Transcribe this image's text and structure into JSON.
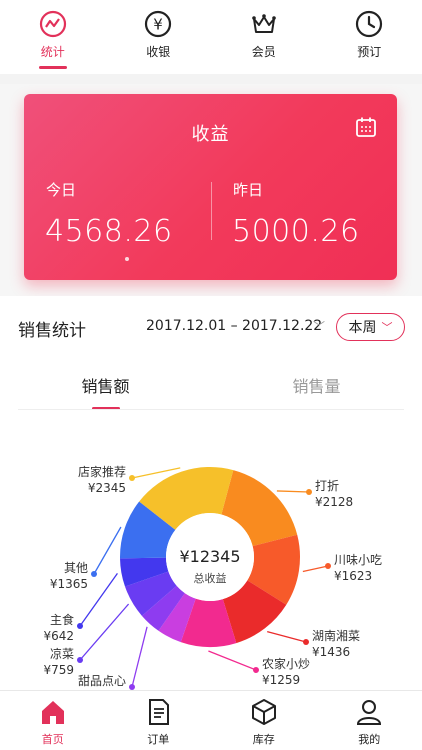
{
  "top_tabs": [
    {
      "label": "统计",
      "icon": "trend-icon",
      "active": true
    },
    {
      "label": "收银",
      "icon": "yen-icon",
      "active": false
    },
    {
      "label": "会员",
      "icon": "crown-icon",
      "active": false
    },
    {
      "label": "预订",
      "icon": "clock-icon",
      "active": false
    }
  ],
  "revenue_card": {
    "title": "收益",
    "today_label": "今日",
    "today_value": "4568.26",
    "yesterday_label": "昨日",
    "yesterday_value": "5000.26",
    "calendar_icon": "calendar-icon"
  },
  "sales": {
    "title": "销售统计",
    "date_range": "2017.12.01 – 2017.12.22",
    "period_button": "本周"
  },
  "sub_tabs": [
    {
      "label": "销售额",
      "active": true
    },
    {
      "label": "销售量",
      "active": false
    }
  ],
  "chart_data": {
    "type": "pie",
    "center_value": "¥12345",
    "center_label": "总收益",
    "slices": [
      {
        "name": "打折",
        "value_label": "¥2128",
        "value": 2128,
        "color": "#f98b1f"
      },
      {
        "name": "川味小吃",
        "value_label": "¥1623",
        "value": 1623,
        "color": "#f75a2a"
      },
      {
        "name": "湖南湘菜",
        "value_label": "¥1436",
        "value": 1436,
        "color": "#ea2b2b"
      },
      {
        "name": "农家小炒",
        "value_label": "¥1259",
        "value": 1259,
        "color": "#f22a8f"
      },
      {
        "name": "",
        "value_label": "",
        "value": 560,
        "color": "#c93ee0"
      },
      {
        "name": "甜品点心",
        "value_label": "",
        "value": 500,
        "color": "#8e3cf0"
      },
      {
        "name": "凉菜",
        "value_label": "¥759",
        "value": 759,
        "color": "#6a3cf2"
      },
      {
        "name": "主食",
        "value_label": "¥642",
        "value": 642,
        "color": "#4338ee"
      },
      {
        "name": "其他",
        "value_label": "¥1365",
        "value": 1365,
        "color": "#3b6ff0"
      },
      {
        "name": "店家推荐",
        "value_label": "¥2345",
        "value": 2345,
        "color": "#f6c02a"
      }
    ]
  },
  "bottom_nav": [
    {
      "label": "首页",
      "icon": "home-icon",
      "active": true
    },
    {
      "label": "订单",
      "icon": "order-icon",
      "active": false
    },
    {
      "label": "库存",
      "icon": "inventory-box-icon",
      "active": false
    },
    {
      "label": "我的",
      "icon": "user-icon",
      "active": false
    }
  ],
  "colors": {
    "accent": "#e2315a",
    "card_start": "#f0507a",
    "card_end": "#f02f55"
  }
}
